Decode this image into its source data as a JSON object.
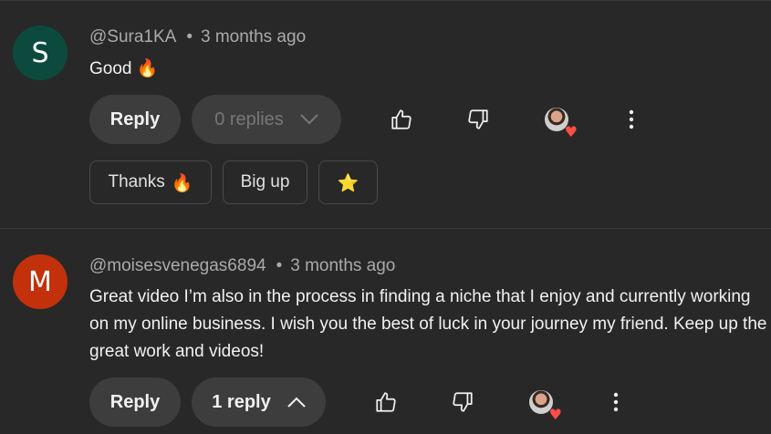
{
  "comments": [
    {
      "avatar_letter": "S",
      "avatar_color": "#0c4a3e",
      "author": "@Sura1KA",
      "separator": "•",
      "time": "3 months ago",
      "text": "Good 🔥",
      "reply_label": "Reply",
      "replies_label": "0 replies",
      "replies_icon": "chevron-down-icon",
      "suggested_replies": [
        {
          "label": "Thanks",
          "emoji": "🔥"
        },
        {
          "label": "Big up",
          "emoji": ""
        },
        {
          "label": "",
          "emoji": "⭐"
        }
      ]
    },
    {
      "avatar_letter": "M",
      "avatar_color": "#c2310b",
      "author": "@moisesvenegas6894",
      "separator": "•",
      "time": "3 months ago",
      "text": "Great video I’m also in the process in finding a niche that I enjoy and currently working on my online business. I wish you the best of luck in your journey my friend. Keep up the great work and videos!",
      "reply_label": "Reply",
      "replies_label": "1 reply",
      "replies_icon": "chevron-up-icon"
    }
  ],
  "icons": {
    "like": "thumbs-up-icon",
    "dislike": "thumbs-down-icon",
    "creator_heart": "creator-heart-icon",
    "more": "more-vertical-icon"
  },
  "colors": {
    "background": "#282828",
    "button": "#3d3d3d",
    "heart": "#ff4e45",
    "meta_text": "#aaaaaa"
  }
}
